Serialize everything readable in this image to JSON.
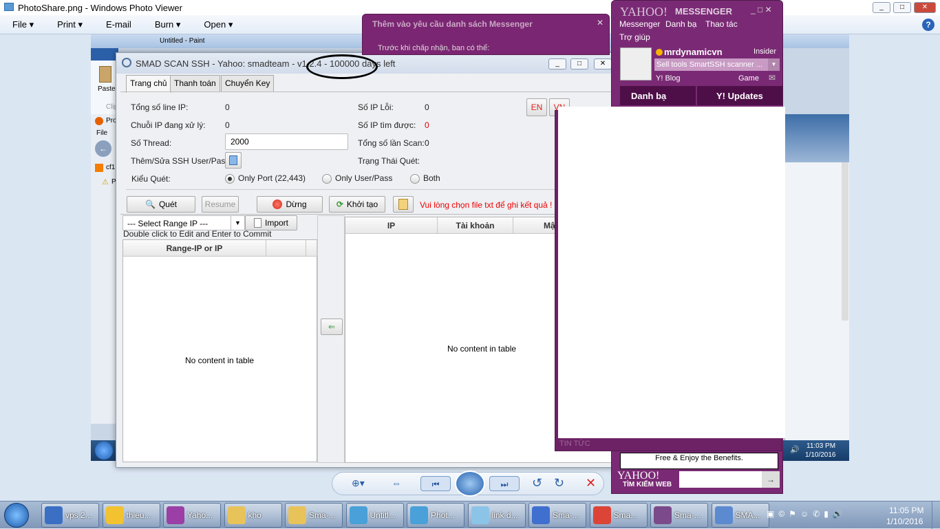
{
  "photo_viewer": {
    "title": "PhotoShare.png - Windows Photo Viewer",
    "menu": [
      "File",
      "Print",
      "E-mail",
      "Burn",
      "Open"
    ],
    "help": "?"
  },
  "inner_screen": {
    "paint_title": "Untitled - Paint",
    "paste": "Paste",
    "clip": "Clip",
    "firefox_tab": "Pro",
    "file_menu": "File",
    "blog_tab": "cf1",
    "warn_tab": "P",
    "clock_time": "11:03 PM",
    "clock_date": "1/10/2016"
  },
  "smad": {
    "title": "SMAD SCAN SSH - Yahoo: smadteam - v1.2.4 - 100000 days left",
    "tabs": [
      "Trang chủ",
      "Thanh toán",
      "Chuyển Key"
    ],
    "lang": [
      "EN",
      "VN"
    ],
    "fields": {
      "total_line_ip": {
        "label": "Tổng số line IP:",
        "value": "0"
      },
      "processing": {
        "label": "Chuỗi IP đang xử lý:",
        "value": "0"
      },
      "thread": {
        "label": "Số Thread:",
        "value": "2000"
      },
      "user_pass": {
        "label": "Thêm/Sửa SSH User/Pass:"
      },
      "scan_type": {
        "label": "Kiểu Quét:",
        "options": [
          "Only Port (22,443)",
          "Only User/Pass",
          "Both"
        ],
        "selected": "Only Port (22,443)"
      },
      "ip_error": {
        "label": "Số IP Lỗi:",
        "value": "0"
      },
      "ip_found": {
        "label": "Số IP tìm được:",
        "value": "0"
      },
      "total_scans": {
        "label": "Tổng số lần Scan:",
        "value": "0"
      },
      "status": {
        "label": "Trạng Thái Quét:",
        "value": ""
      }
    },
    "buttons": {
      "scan": "Quét",
      "resume": "Resume",
      "stop": "Dừng",
      "restart": "Khởi tạo"
    },
    "warning": "Vui lòng chọn file txt để ghi kết quả !",
    "select_range": "--- Select Range IP ---",
    "import": "Import",
    "hint": "Double click to Edit and Enter to Commit",
    "left_table": {
      "columns": [
        "Range-IP or IP",
        ""
      ],
      "empty": "No content in table"
    },
    "right_table": {
      "columns": [
        "IP",
        "Tài khoản",
        "Mậ"
      ],
      "empty": "No content in table"
    }
  },
  "messenger_dialog": {
    "title": "Thêm vào yêu cầu danh sách Messenger",
    "group": "Trước khi chấp nhận, ban có thể:"
  },
  "yahoo": {
    "logo": "YAHOO!",
    "product": "MESSENGER",
    "menu": [
      "Messenger",
      "Danh bạ",
      "Thao tác",
      "Trợ giúp"
    ],
    "username": "mrdynamicvn",
    "insider": "Insider",
    "status": "Sell  tools  SmartSSH scanner  ...",
    "blog": "Y! Blog",
    "game": "Game",
    "tabs": [
      "Danh bạ",
      "Y! Updates"
    ],
    "news": "TIN TỨC",
    "promo": "Free & Enjoy the Benefits.",
    "search_label": "TÌM KIẾM WEB"
  },
  "taskbar": {
    "items": [
      "vps 2...",
      "thieu...",
      "Yaho...",
      "kho",
      "Sma-...",
      "Untitl...",
      "Phot...",
      "link d...",
      "Sma-...",
      "Sma...",
      "Sma-...",
      "SMA..."
    ],
    "icon_colors": [
      "#3a6fc4",
      "#f2c230",
      "#9b3fa6",
      "#e8c35a",
      "#e8c35a",
      "#4aa0d8",
      "#4aa0d8",
      "#8cc4e8",
      "#3f6fcf",
      "#db4437",
      "#7b4a8a",
      "#5b8ad0"
    ],
    "time": "11:05 PM",
    "date": "1/10/2016"
  }
}
